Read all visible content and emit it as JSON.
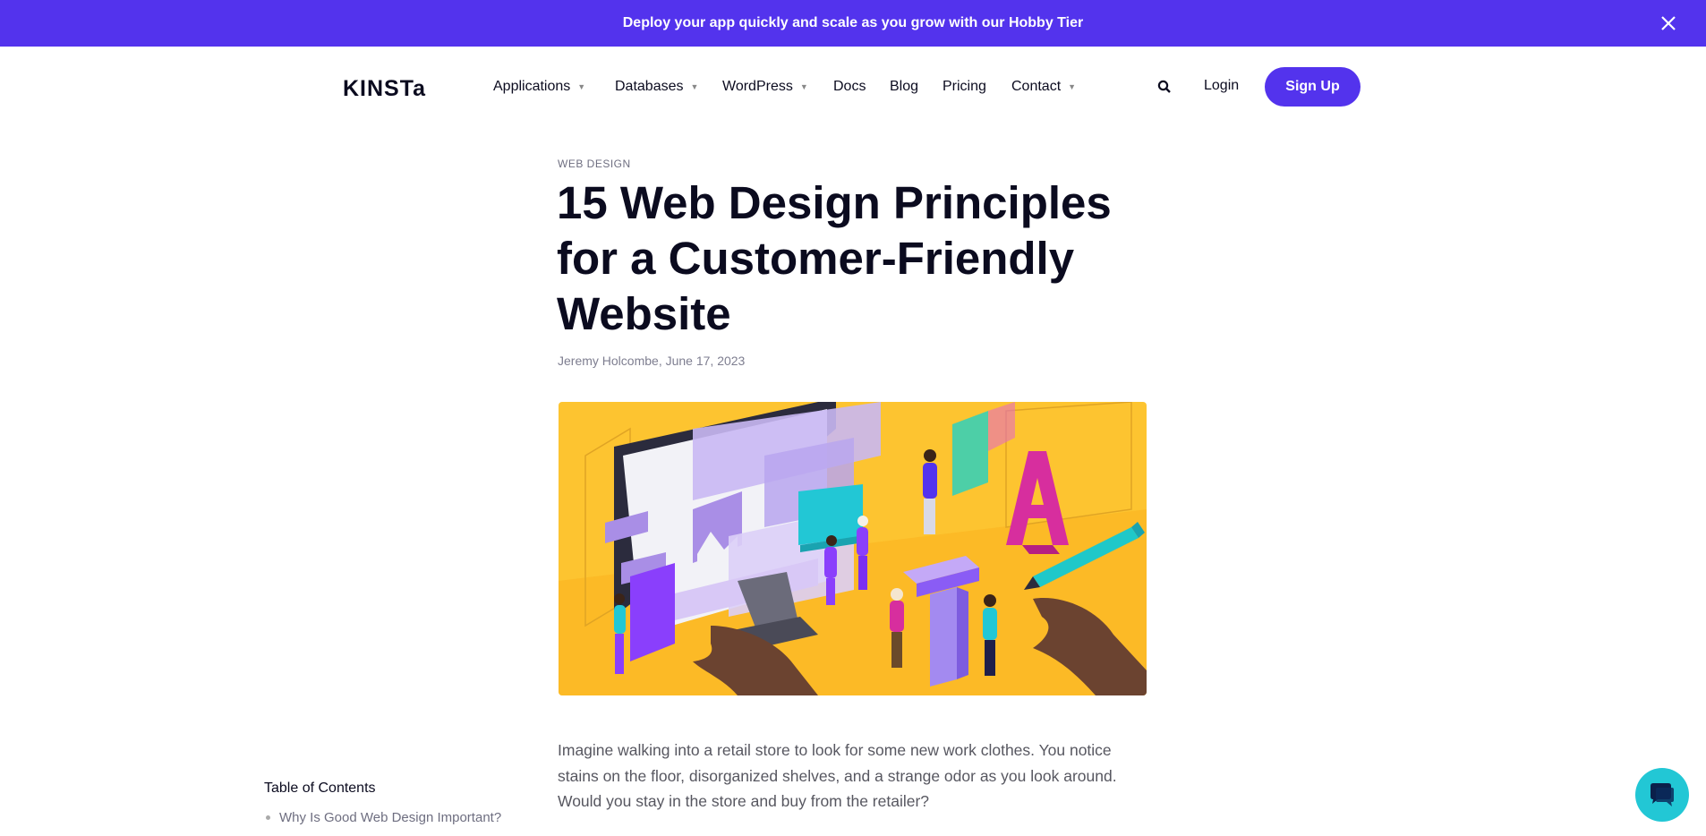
{
  "promo": {
    "text": "Deploy your app quickly and scale as you grow with our Hobby Tier",
    "close_icon": "close-icon"
  },
  "header": {
    "logo": "KINSTa",
    "nav": [
      {
        "label": "Applications",
        "dropdown": true
      },
      {
        "label": "Databases",
        "dropdown": true
      },
      {
        "label": "WordPress",
        "dropdown": true
      },
      {
        "label": "Docs",
        "dropdown": false
      },
      {
        "label": "Blog",
        "dropdown": false
      },
      {
        "label": "Pricing",
        "dropdown": false
      },
      {
        "label": "Contact",
        "dropdown": true
      }
    ],
    "search_icon": "search-icon",
    "login_label": "Login",
    "signup_label": "Sign Up"
  },
  "article": {
    "category": "WEB DESIGN",
    "title": "15 Web Design Principles for a Customer-Friendly Website",
    "byline": "Jeremy Holcombe, June 17, 2023",
    "intro": "Imagine walking into a retail store to look for some new work clothes. You notice stains on the floor, disorganized shelves, and a strange odor as you look around. Would you stay in the store and buy from the retailer?"
  },
  "toc": {
    "title": "Table of Contents",
    "items": [
      "Why Is Good Web Design Important?"
    ]
  },
  "colors": {
    "brand": "#5333ed",
    "hero_bg": "#fdc430",
    "chat": "#22c7d5"
  }
}
